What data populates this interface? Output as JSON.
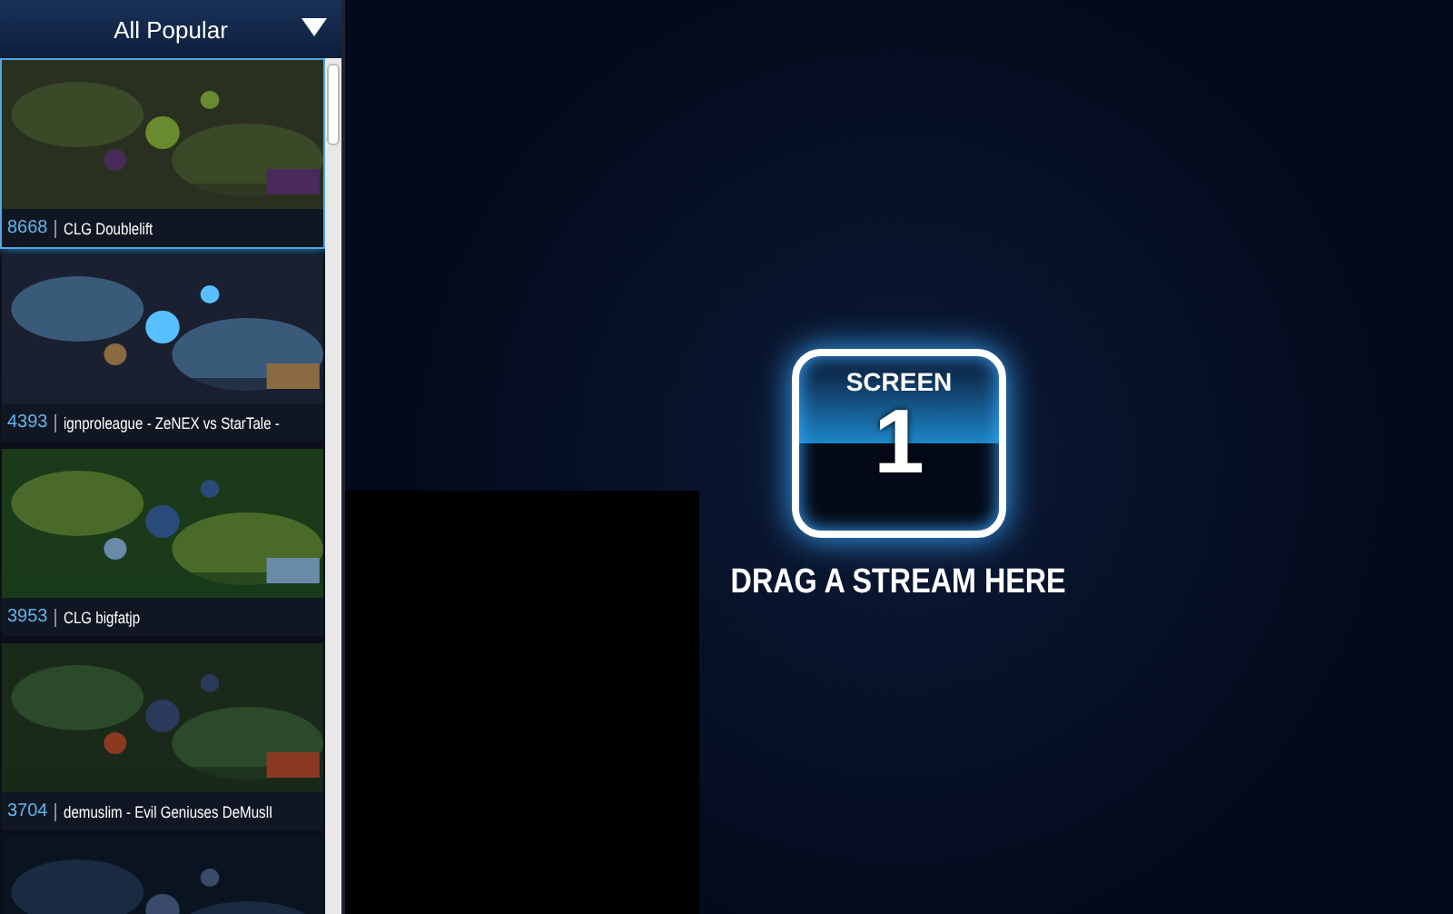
{
  "sidebar": {
    "filter": {
      "label": "All Popular"
    },
    "streams": [
      {
        "kind": "stream",
        "viewers": "8668",
        "title": "CLG Doublelift",
        "selected": true
      },
      {
        "kind": "stream",
        "viewers": "4393",
        "title": "ignproleague - ZeNEX vs StarTale -",
        "selected": false
      },
      {
        "kind": "stream",
        "viewers": "3953",
        "title": "CLG bigfatjp",
        "selected": false
      },
      {
        "kind": "stream",
        "viewers": "3704",
        "title": "demuslim - Evil Geniuses DeMuslI",
        "selected": false
      },
      {
        "kind": "picture"
      }
    ]
  },
  "screen": {
    "label": "SCREEN",
    "number": "1",
    "hint": "DRAG A STREAM HERE"
  }
}
